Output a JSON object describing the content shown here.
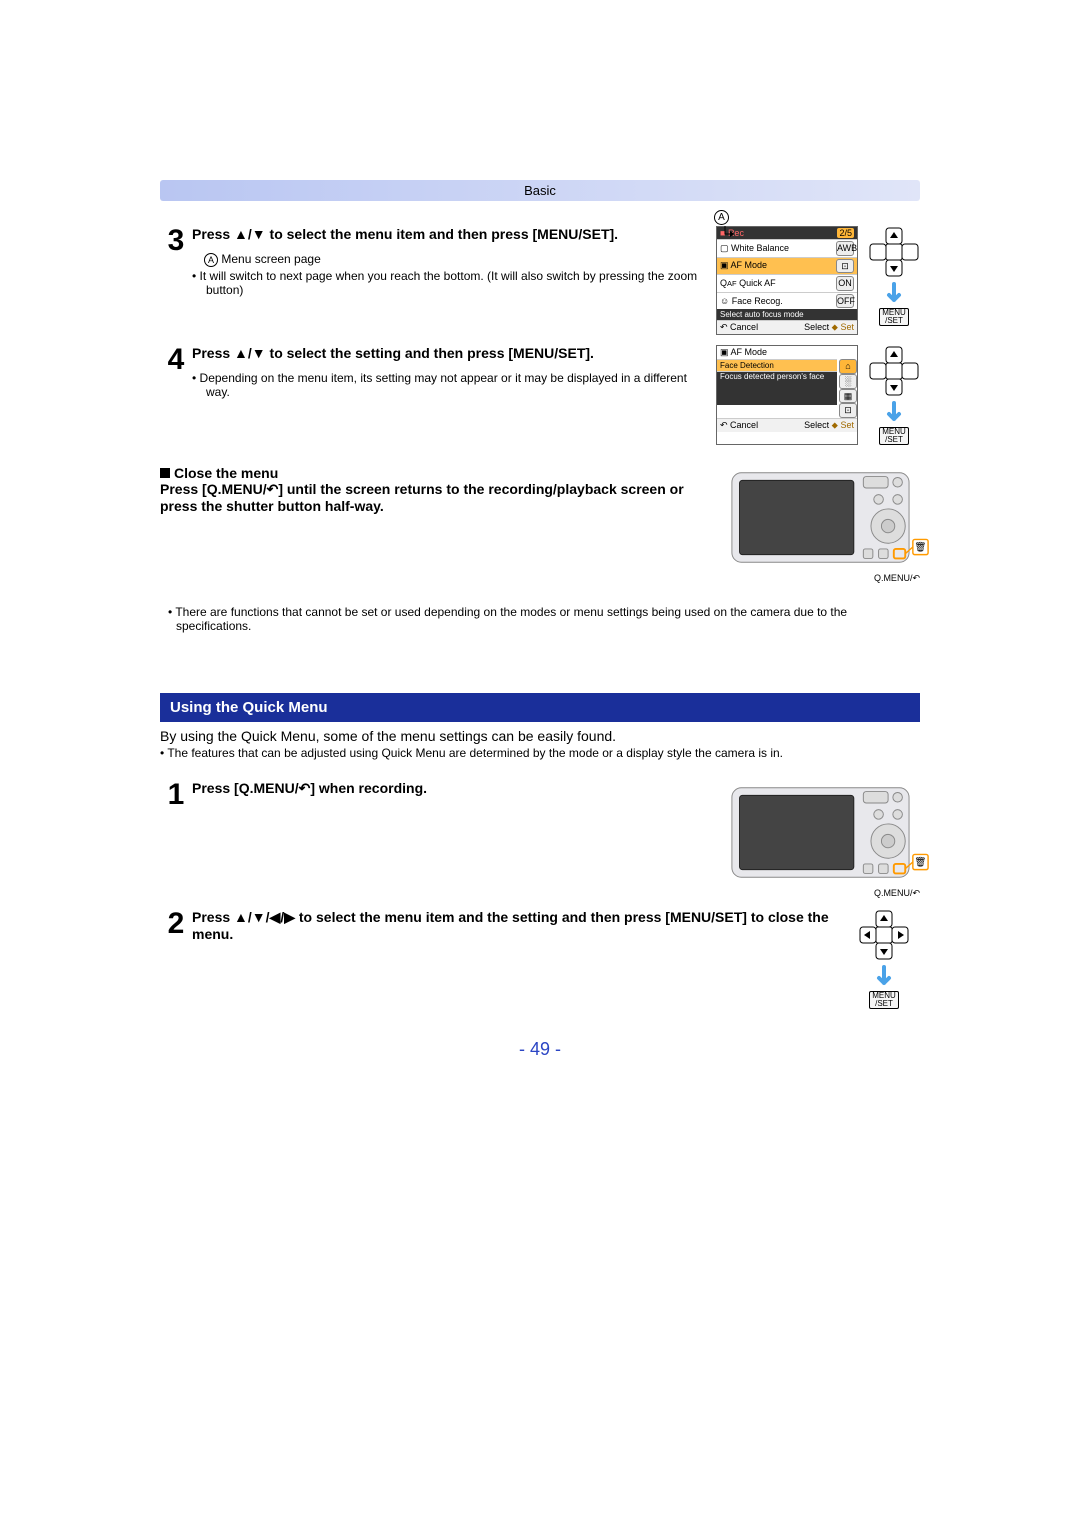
{
  "header": "Basic",
  "steps_a": [
    {
      "num": "3",
      "head_pre": "Press ",
      "head_mid": "/",
      "head_post": " to select the menu item and then press [MENU/SET].",
      "caption_label": "A",
      "caption": "Menu screen page",
      "bullet": "It will switch to next page when you reach the bottom. (It will also switch by pressing the zoom button)"
    },
    {
      "num": "4",
      "head_pre": "Press ",
      "head_mid": "/",
      "head_post": " to select the setting and then press [MENU/SET].",
      "bullet": "Depending on the menu item, its setting may not appear or it may be displayed in a different way."
    }
  ],
  "close": {
    "title": "Close the menu",
    "body_pre": "Press [Q.MENU/",
    "body_post": "] until the screen returns to the recording/playback screen or press the shutter button half-way."
  },
  "note": "There are functions that cannot be set or used depending on the modes or menu settings being used on the camera due to the specifications.",
  "quick_menu": {
    "heading": "Using the Quick Menu",
    "intro": "By using the Quick Menu, some of the menu settings can be easily found.",
    "intro_sub": "The features that can be adjusted using Quick Menu are determined by the mode or a display style the camera is in.",
    "steps": [
      {
        "num": "1",
        "head_pre": "Press [Q.MENU/",
        "head_post": "] when recording."
      },
      {
        "num": "2",
        "head_pre": "Press ",
        "head_mid1": "/",
        "head_mid2": "/",
        "head_mid3": "/",
        "head_post": " to select the menu item and the setting and then press [MENU/SET] to close the menu."
      }
    ]
  },
  "menu_screen_1": {
    "tab_rec": "Rec",
    "page_indicator_cur": "2",
    "page_indicator_total": "5",
    "rows": [
      {
        "label": "White Balance",
        "val": "AWB"
      },
      {
        "label": "AF Mode",
        "val": "⊡"
      },
      {
        "label": "Quick AF",
        "val": "ON"
      },
      {
        "label": "Face Recog.",
        "val": "OFF"
      }
    ],
    "hint": "Select auto focus mode",
    "foot_cancel": "Cancel",
    "foot_select": "Select",
    "foot_set": "Set"
  },
  "menu_screen_2": {
    "title": "AF Mode",
    "rows": [
      {
        "label": "Face Detection"
      },
      {
        "label": "Focus detected person's face"
      }
    ],
    "icons": [
      "⌂",
      "░",
      "▦",
      "⊡"
    ],
    "foot_cancel": "Cancel",
    "foot_select": "Select",
    "foot_set": "Set"
  },
  "qmenu_label": "Q.MENU/",
  "menuset_label_top": "MENU",
  "menuset_label_bot": "/SET",
  "page_number": "- 49 -"
}
